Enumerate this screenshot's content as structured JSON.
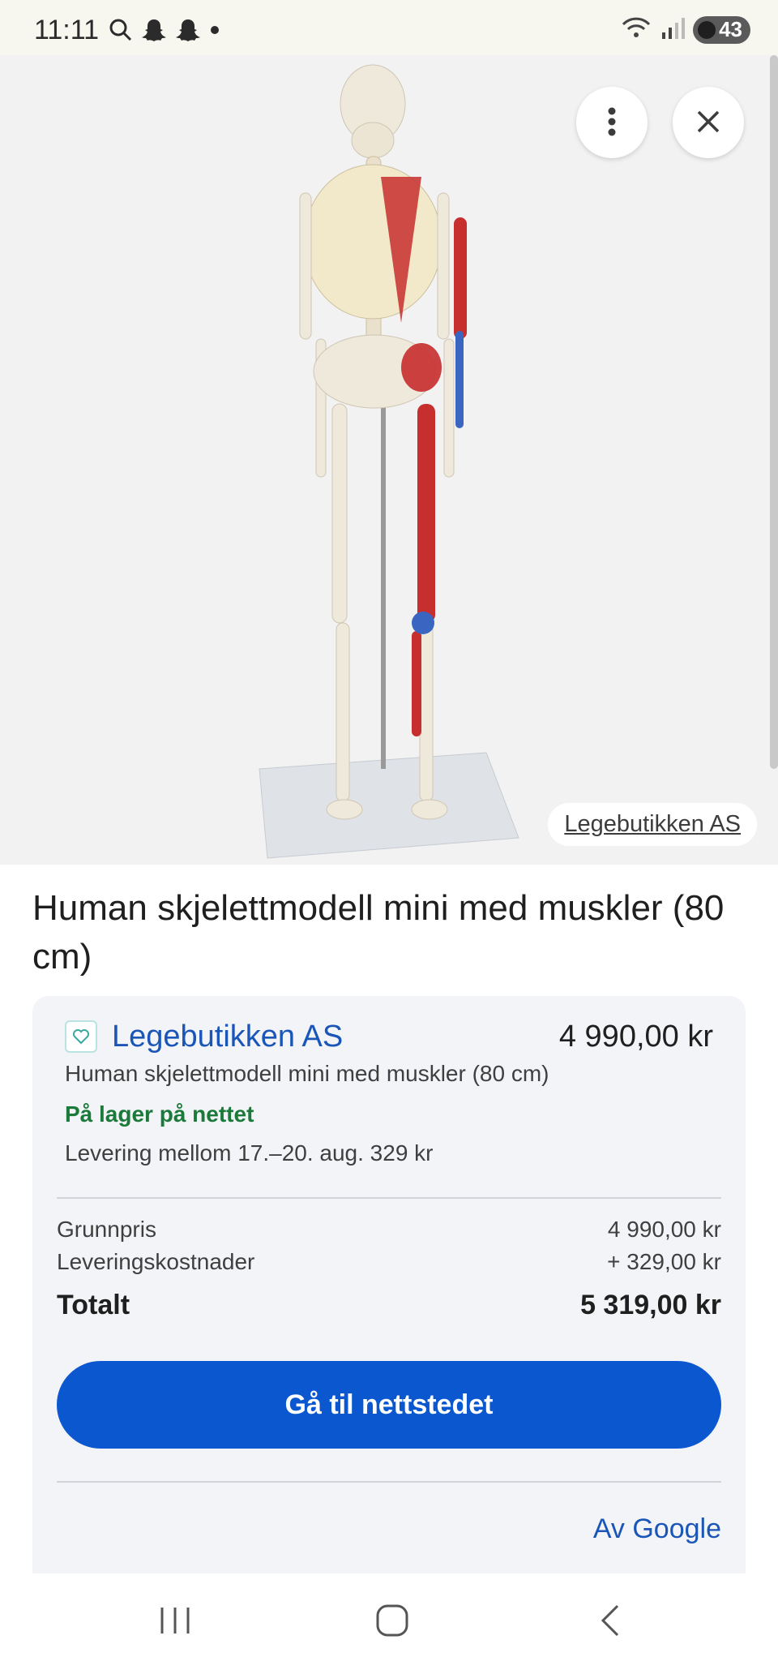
{
  "status_bar": {
    "time": "11:11",
    "battery_level": "43",
    "icons_left": [
      "search-icon",
      "snapchat-icon",
      "snapchat-icon",
      "dot-icon"
    ],
    "icons_right": [
      "wifi-icon",
      "signal-icon",
      "battery-icon"
    ]
  },
  "image_viewer": {
    "source_label": "Legebutikken AS",
    "more_icon": "more-vertical-icon",
    "close_icon": "close-icon"
  },
  "product": {
    "title": "Human skjelettmodell mini med muskler (80 cm)"
  },
  "offer": {
    "merchant_name": "Legebutikken AS",
    "price": "4 990,00 kr",
    "description": "Human skjelettmodell mini med muskler (80 cm)",
    "stock": "På lager på nettet",
    "delivery": "Levering mellom 17.–20. aug. 329 kr",
    "breakdown": {
      "base_label": "Grunnpris",
      "base_value": "4 990,00 kr",
      "shipping_label": "Leveringskostnader",
      "shipping_value": "+ 329,00 kr",
      "total_label": "Totalt",
      "total_value": "5 319,00 kr"
    },
    "cta_label": "Gå til nettstedet",
    "by_google": "Av Google"
  },
  "colors": {
    "accent": "#0b57d0",
    "link": "#1a55b8",
    "stock_green": "#1b7a3a"
  }
}
